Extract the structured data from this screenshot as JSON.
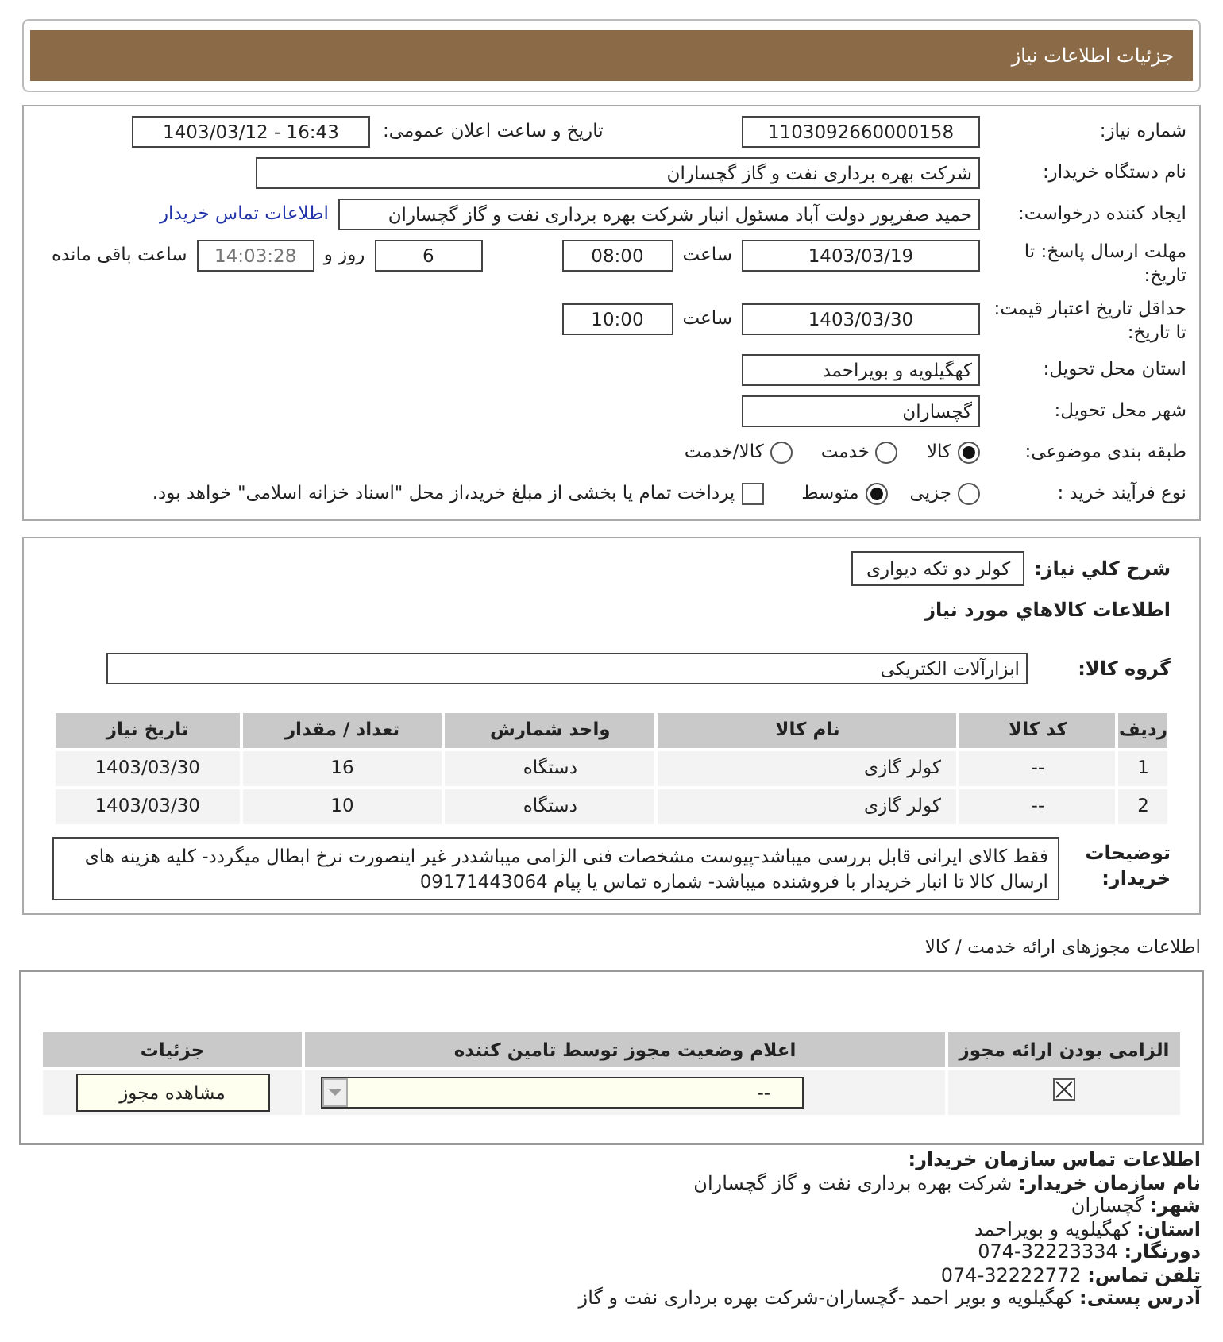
{
  "page_title": "جزئیات اطلاعات نیاز",
  "need_number": {
    "label": "شماره نیاز:",
    "value": "1103092660000158"
  },
  "announce_datetime": {
    "label": "تاریخ و ساعت اعلان عمومی:",
    "value": "1403/03/12 - 16:43"
  },
  "buyer_org": {
    "label": "نام دستگاه خریدار:",
    "value": "شرکت بهره برداری نفت و گاز گچساران"
  },
  "requester": {
    "label": "ایجاد کننده درخواست:",
    "value": "حمید  صفرپور دولت آباد مسئول انبار شرکت بهره برداری نفت و گاز گچساران",
    "contact_link": "اطلاعات تماس خریدار"
  },
  "response_deadline": {
    "label": "مهلت ارسال پاسخ: تا تاریخ:",
    "date": "1403/03/19",
    "time_label": "ساعت",
    "time": "08:00",
    "days": "6",
    "days_label": "روز و",
    "remaining": "14:03:28",
    "remaining_label": "ساعت باقی مانده"
  },
  "price_validity": {
    "label": "حداقل تاریخ اعتبار قیمت: تا تاریخ:",
    "date": "1403/03/30",
    "time_label": "ساعت",
    "time": "10:00"
  },
  "delivery_province": {
    "label": "استان محل تحویل:",
    "value": "کهگیلویه و بویراحمد"
  },
  "delivery_city": {
    "label": "شهر محل تحویل:",
    "value": "گچساران"
  },
  "category": {
    "label": "طبقه بندی موضوعی:",
    "options": [
      {
        "label": "کالا",
        "selected": true
      },
      {
        "label": "خدمت",
        "selected": false
      },
      {
        "label": "کالا/خدمت",
        "selected": false
      }
    ]
  },
  "purchase_type": {
    "label": "نوع فرآیند خرید :",
    "options": [
      {
        "label": "جزیی",
        "selected": false
      },
      {
        "label": "متوسط",
        "selected": true
      }
    ],
    "payment": {
      "label": "پرداخت تمام یا بخشی از مبلغ خرید،از محل \"اسناد خزانه اسلامی\" خواهد بود.",
      "checked": false
    }
  },
  "summary": {
    "label": "شرح کلي نياز:",
    "value": "کولر دو تکه دیواری"
  },
  "goods_heading": "اطلاعات کالاهاي مورد نياز",
  "goods_group": {
    "label": "گروه کالا:",
    "value": "ابزارآلات الکتریکی"
  },
  "goods_table": {
    "columns": [
      "رديف",
      "کد کالا",
      "نام کالا",
      "واحد شمارش",
      "تعداد / مقدار",
      "تاریخ نیاز"
    ],
    "rows": [
      [
        "1",
        "--",
        "کولر گازی",
        "دستگاه",
        "16",
        "1403/03/30"
      ],
      [
        "2",
        "--",
        "کولر گازی",
        "دستگاه",
        "10",
        "1403/03/30"
      ]
    ]
  },
  "buyer_notes": {
    "label": "توضیحات خریدار:",
    "value": "فقط کالای ایرانی قابل بررسی میباشد-پیوست مشخصات فنی الزامی میباشددر غیر اینصورت نرخ ابطال میگردد- کلیه هزینه های ارسال کالا تا انبار خریدار با فروشنده میباشد- شماره تماس یا پیام 09171443064"
  },
  "licenses": {
    "title": "اطلاعات مجوزهای ارائه خدمت / کالا",
    "columns": [
      "الزامی بودن ارائه مجوز",
      "اعلام وضعیت مجوز توسط تامین کننده",
      "جزئیات"
    ],
    "rows": [
      {
        "required": true,
        "status": "--",
        "action": "مشاهده مجوز"
      }
    ]
  },
  "contact": {
    "title": "اطلاعات تماس سازمان خریدار:",
    "items": [
      {
        "label": "نام سازمان خریدار:",
        "value": "شرکت بهره برداری نفت و گاز گچساران"
      },
      {
        "label": "شهر:",
        "value": "گچساران"
      },
      {
        "label": "استان:",
        "value": "کهگیلویه و بویراحمد"
      },
      {
        "label": "دورنگار:",
        "value": "32223334-074"
      },
      {
        "label": "تلفن تماس:",
        "value": "32222772-074"
      },
      {
        "label": "آدرس پستی:",
        "value": "کهگیلویه و بویر احمد -گچساران-شرکت بهره برداری نفت و گاز"
      }
    ]
  }
}
